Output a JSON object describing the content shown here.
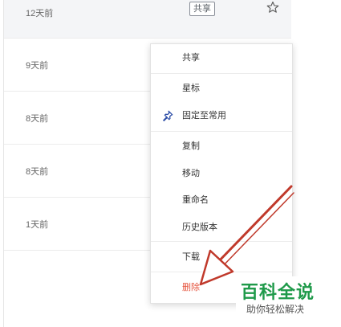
{
  "file_list": {
    "rows": [
      {
        "time": "12天前",
        "share_tag": "共享"
      },
      {
        "time": "9天前"
      },
      {
        "time": "8天前"
      },
      {
        "time": "8天前"
      },
      {
        "time": "1天前"
      }
    ]
  },
  "context_menu": {
    "items": [
      {
        "label": "共享"
      },
      {
        "label": "星标"
      },
      {
        "label": "固定至常用",
        "icon": "pin-icon"
      },
      {
        "label": "复制"
      },
      {
        "label": "移动"
      },
      {
        "label": "重命名"
      },
      {
        "label": "历史版本"
      },
      {
        "label": "下载"
      },
      {
        "label": "删除"
      }
    ]
  },
  "watermark": {
    "title": "百科全说",
    "subtitle": "助你轻松解决"
  },
  "colors": {
    "danger": "#e5533d",
    "arrow": "#c0392b",
    "watermark_green": "#1f9a4a",
    "row_highlight": "#f4f5f7"
  }
}
